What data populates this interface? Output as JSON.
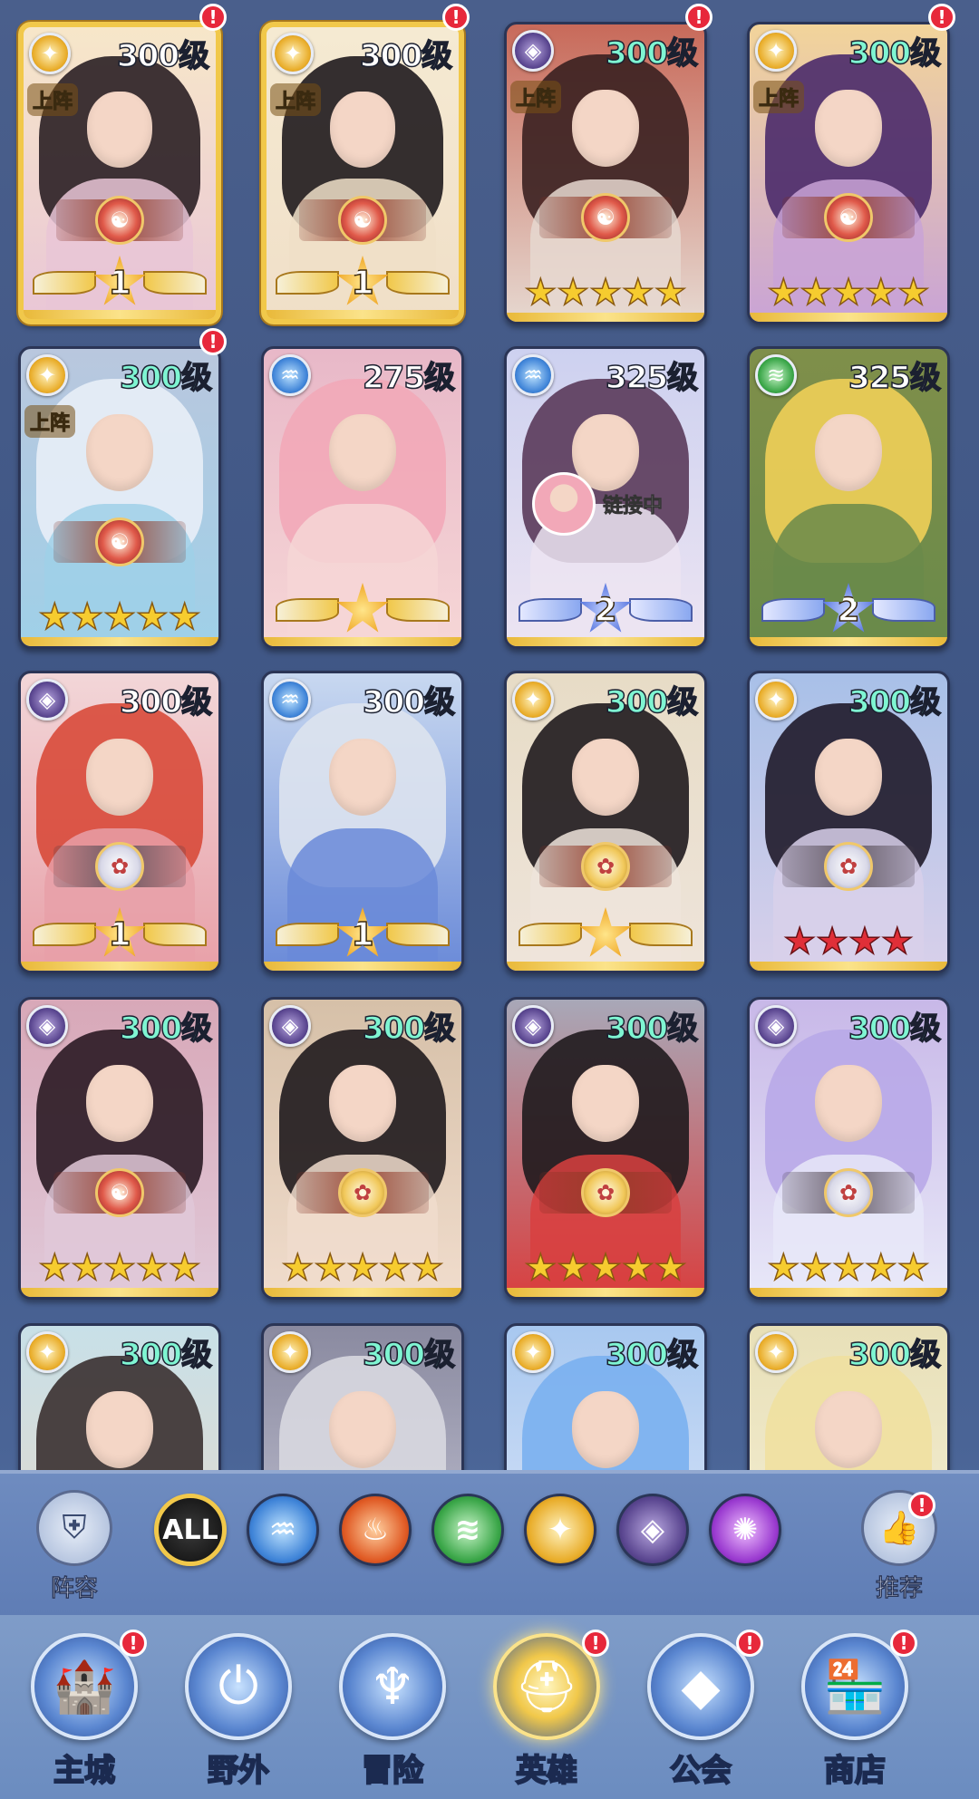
{
  "colors": {
    "gold_frame": "#f1c84a",
    "level_teal": "#7ff5d2",
    "level_white": "#ffffff",
    "notify_red": "#e7283b",
    "star_gold": "#f6cc2f",
    "star_red": "#e02f38"
  },
  "heroes": [
    {
      "level": "300级",
      "faction_icon": "light-icon",
      "deployed": "上阵",
      "rank_type": "wings",
      "rank": "1",
      "emblem": "dragon",
      "notify": "!",
      "frame": "gold"
    },
    {
      "level": "300级",
      "faction_icon": "light-icon",
      "deployed": "上阵",
      "rank_type": "wings",
      "rank": "1",
      "emblem": "dragon",
      "notify": "!",
      "frame": "gold"
    },
    {
      "level": "300级",
      "faction_icon": "dark-icon",
      "deployed": "上阵",
      "rank_type": "stars",
      "stars": 5,
      "emblem": "dragon",
      "notify": "!"
    },
    {
      "level": "300级",
      "faction_icon": "light-icon",
      "deployed": "上阵",
      "rank_type": "stars",
      "stars": 5,
      "emblem": "dragon",
      "notify": "!"
    },
    {
      "level": "300级",
      "faction_icon": "light-icon",
      "deployed": "上阵",
      "rank_type": "stars",
      "stars": 5,
      "emblem": "dragon",
      "notify": "!"
    },
    {
      "level": "275级",
      "faction_icon": "water-icon",
      "rank_type": "wings-star"
    },
    {
      "level": "325级",
      "faction_icon": "water-icon",
      "rank_type": "wings-blue",
      "rank": "2",
      "linking": "链接中"
    },
    {
      "level": "325级",
      "faction_icon": "wind-icon",
      "rank_type": "wings-blue",
      "rank": "2"
    },
    {
      "level": "300级",
      "faction_icon": "dark-icon",
      "rank_type": "wings",
      "rank": "1",
      "emblem": "silver"
    },
    {
      "level": "300级",
      "faction_icon": "water-icon",
      "rank_type": "wings",
      "rank": "1"
    },
    {
      "level": "300级",
      "faction_icon": "light-icon",
      "rank_type": "wings-star",
      "emblem": "gold2"
    },
    {
      "level": "300级",
      "faction_icon": "light-icon",
      "rank_type": "stars-red",
      "stars": 4,
      "emblem": "silver"
    },
    {
      "level": "300级",
      "faction_icon": "dark-icon",
      "rank_type": "stars",
      "stars": 5,
      "emblem": "dragon"
    },
    {
      "level": "300级",
      "faction_icon": "dark-icon",
      "rank_type": "stars",
      "stars": 5,
      "emblem": "gold2"
    },
    {
      "level": "300级",
      "faction_icon": "dark-icon",
      "rank_type": "stars",
      "stars": 5,
      "emblem": "gold2"
    },
    {
      "level": "300级",
      "faction_icon": "dark-icon",
      "rank_type": "stars",
      "stars": 5,
      "emblem": "silver"
    },
    {
      "level": "300级",
      "faction_icon": "light-icon",
      "rank_type": "none"
    },
    {
      "level": "300级",
      "faction_icon": "light-icon",
      "rank_type": "none"
    },
    {
      "level": "300级",
      "faction_icon": "light-icon",
      "rank_type": "none"
    },
    {
      "level": "300级",
      "faction_icon": "light-icon",
      "rank_type": "none"
    }
  ],
  "filter_bar": {
    "lineup_label": "阵容",
    "recommend_label": "推荐",
    "recommend_notify": "!",
    "filters": [
      {
        "id": "all",
        "label": "ALL",
        "icon": "all-icon",
        "selected": true
      },
      {
        "id": "water",
        "label": "",
        "icon": "water-icon"
      },
      {
        "id": "fire",
        "label": "",
        "icon": "fire-icon"
      },
      {
        "id": "wind",
        "label": "",
        "icon": "wind-icon"
      },
      {
        "id": "light",
        "label": "",
        "icon": "light-icon"
      },
      {
        "id": "dark",
        "label": "",
        "icon": "dark-icon"
      },
      {
        "id": "chaos",
        "label": "",
        "icon": "chaos-icon"
      }
    ]
  },
  "bottom_nav": [
    {
      "label": "主城",
      "icon": "castle-icon",
      "notify": "!"
    },
    {
      "label": "野外",
      "icon": "wild-icon",
      "notify": ""
    },
    {
      "label": "冒险",
      "icon": "adventure-icon",
      "notify": ""
    },
    {
      "label": "英雄",
      "icon": "hero-helmet-icon",
      "notify": "!",
      "active": true
    },
    {
      "label": "公会",
      "icon": "guild-icon",
      "notify": "!"
    },
    {
      "label": "商店",
      "icon": "shop-icon",
      "notify": "!"
    }
  ]
}
